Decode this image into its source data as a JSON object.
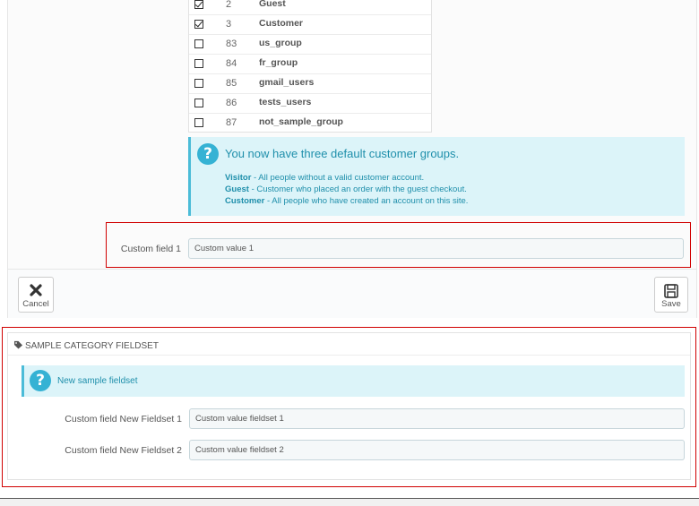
{
  "groups": [
    {
      "id": "2",
      "name": "Guest",
      "checked": true
    },
    {
      "id": "3",
      "name": "Customer",
      "checked": true
    },
    {
      "id": "83",
      "name": "us_group",
      "checked": false
    },
    {
      "id": "84",
      "name": "fr_group",
      "checked": false
    },
    {
      "id": "85",
      "name": "gmail_users",
      "checked": false
    },
    {
      "id": "86",
      "name": "tests_users",
      "checked": false
    },
    {
      "id": "87",
      "name": "not_sample_group",
      "checked": false
    }
  ],
  "info": {
    "title": "You now have three default customer groups.",
    "lines": [
      {
        "term": "Visitor",
        "text": " - All people without a valid customer account."
      },
      {
        "term": "Guest",
        "text": " - Customer who placed an order with the guest checkout."
      },
      {
        "term": "Customer",
        "text": " - All people who have created an account on this site."
      }
    ]
  },
  "custom_field": {
    "label": "Custom field 1",
    "value": "Custom value 1"
  },
  "footer": {
    "cancel_label": "Cancel",
    "save_label": "Save"
  },
  "fieldset": {
    "title": "SAMPLE CATEGORY FIELDSET",
    "alert_text": "New sample fieldset",
    "fields": [
      {
        "label": "Custom field New Fieldset 1",
        "value": "Custom value fieldset 1"
      },
      {
        "label": "Custom field New Fieldset 2",
        "value": "Custom value fieldset 2"
      }
    ]
  },
  "colors": {
    "highlight_border": "#d00000",
    "alert_bg": "#dcf4f9",
    "alert_accent": "#35b2d4"
  },
  "icons": {
    "info": "question-circle-icon",
    "cancel": "close-icon",
    "save": "floppy-disk-icon",
    "fieldset": "tag-icon"
  }
}
